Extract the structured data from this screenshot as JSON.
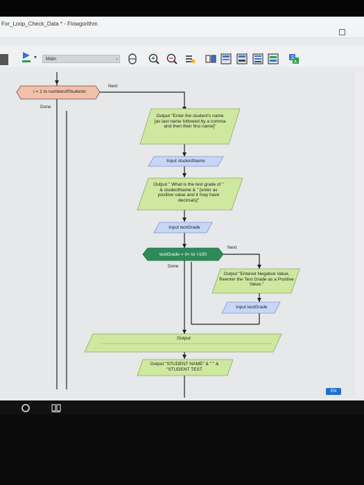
{
  "window": {
    "title": "For_Loop_Check_Data * - Flowgorithm"
  },
  "toolbar": {
    "function_selected": "Main",
    "run_dropdown_glyph": "▾",
    "icons": [
      "run-icon",
      "variable-watch-icon",
      "zoom-in-icon",
      "zoom-out-icon",
      "style-icon",
      "layout-icon",
      "chart-icon",
      "chart-icon-2",
      "chart-icon-3",
      "chart-icon-4",
      "translate-icon"
    ]
  },
  "flowchart": {
    "for_loop": {
      "label": "i = 1 to numberofStudents",
      "next_label": "Next",
      "done_label": "Done"
    },
    "output_prompt_name": "Output \"Enter the student's name [as last name followed by a comma and then their first name]\"",
    "input_name": "Input studentName",
    "output_prompt_grade": "Output \" What is the test grade of \" & studentName & \" [enter as positive value and it may have decimals]\"",
    "input_grade": "Input testGrade",
    "while_loop": {
      "label": "testGrade = 0< to <100",
      "next_label": "Next",
      "done_label": "Done"
    },
    "output_negative": "Output \"Entered Negative Value, Reenter the Test Grade as a Positive Value.\"",
    "input_grade_retry": "Input testGrade",
    "output_empty": "Output",
    "output_report": "Output \"STUDENT NAME\" & \" \" & \"STUDENT TEST"
  },
  "taskbar": {
    "language": "EN"
  },
  "colors": {
    "for_loop": "#f2c0a8",
    "output_fill": "#cfe8a0",
    "input_fill": "#c7d6f6",
    "while_fill": "#2e8b57",
    "accent_blue": "#1f6fd0"
  }
}
